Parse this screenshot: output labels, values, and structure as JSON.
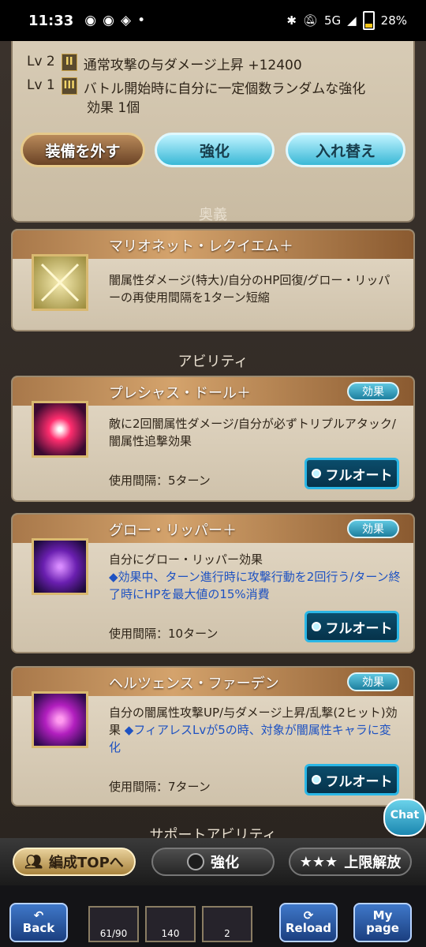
{
  "status_bar": {
    "time": "11:33",
    "battery": "28%",
    "network": "5G"
  },
  "top_panel": {
    "rows": [
      {
        "lv": "Lv 2",
        "roman": "II",
        "text": "通常攻撃の与ダメージ上昇 +12400"
      },
      {
        "lv": "Lv 1",
        "roman": "III",
        "text": "バトル開始時に自分に一定個数ランダムな強化"
      },
      {
        "lv": "",
        "roman": "",
        "text": "効果 1個"
      }
    ],
    "buttons": {
      "unequip": "装備を外す",
      "enhance": "強化",
      "swap": "入れ替え"
    }
  },
  "ougi": {
    "section_title": "奥義",
    "name": "マリオネット・レクイエム＋",
    "desc": "闇属性ダメージ(特大)/自分のHP回復/グロー・リッパーの再使用間隔を1ターン短縮"
  },
  "abilities": {
    "section_title": "アビリティ",
    "badge": "効果",
    "interval_prefix": "使用間隔：",
    "fullauto": "フルオート",
    "items": [
      {
        "name": "プレシャス・ドール＋",
        "desc": "敵に2回闇属性ダメージ/自分が必ずトリプルアタック/闇属性追撃効果",
        "highlight": "",
        "interval": "使用間隔：5ターン"
      },
      {
        "name": "グロー・リッパー＋",
        "desc": "自分にグロー・リッパー効果",
        "highlight": "◆効果中、ターン進行時に攻撃行動を2回行う/ターン終了時にHPを最大値の15%消費",
        "interval": "使用間隔：10ターン"
      },
      {
        "name": "ヘルツェンス・ファーデン",
        "desc": "自分の闇属性攻撃UP/与ダメージ上昇/乱撃(2ヒット)効果",
        "highlight": "◆フィアレスLvが5の時、対象が闇属性キャラに変化",
        "interval": "使用間隔：7ターン"
      }
    ]
  },
  "support_title": "サポートアビリティ",
  "chat_label": "Chat",
  "bottom_nav": {
    "party_top": "編成TOPへ",
    "enhance": "強化",
    "limit_break": "上限解放"
  },
  "game_ui": {
    "back": "Back",
    "reload": "Reload",
    "mypage": "My page",
    "stat1": "61/90",
    "stat2": "140",
    "stat3": "2"
  },
  "colors": {
    "accent_cyan": "#39b8d6",
    "highlight_blue": "#1e52c2",
    "gold": "#d9b970"
  }
}
